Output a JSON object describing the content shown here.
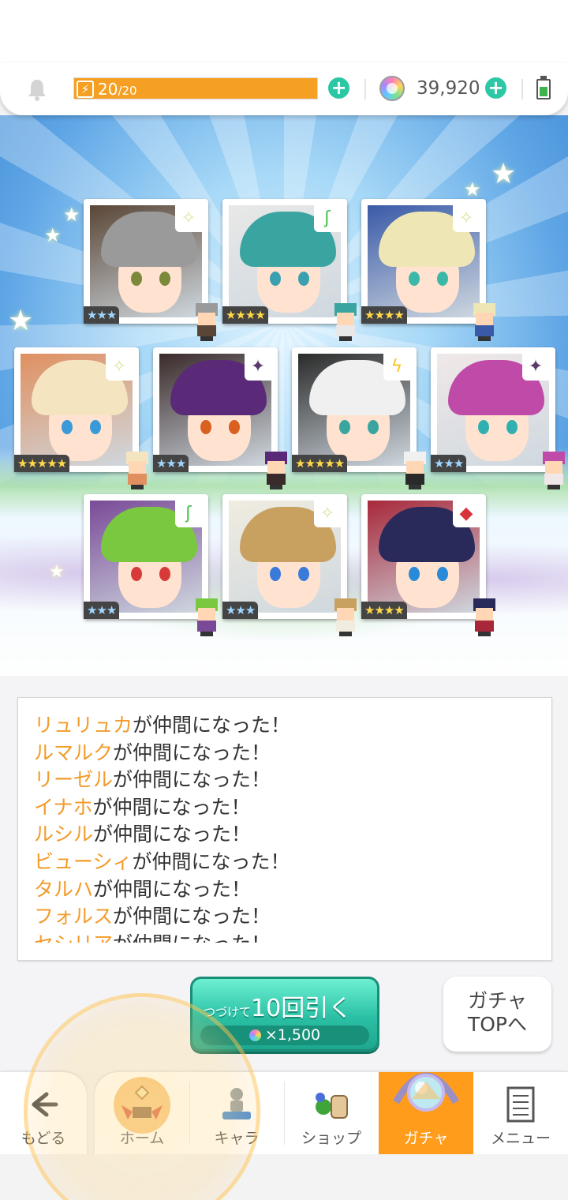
{
  "status": {
    "stamina_current": "20",
    "stamina_max": "/20",
    "stamina_fraction": 1.0,
    "stamina_icon": "lightning-icon",
    "gem_count": "39,920",
    "plus_symbol": "+"
  },
  "cards": [
    {
      "rarity": "★★★",
      "element": "✧",
      "element_color": "#d7e6a0",
      "hair": "#9a9a9a",
      "eye": "#7a8a3a",
      "accent": "#5a4636"
    },
    {
      "rarity": "★★★★",
      "element": "ʃ",
      "element_color": "#45c04a",
      "hair": "#3aa5a0",
      "eye": "#3aa0b0",
      "accent": "#e8e8e8"
    },
    {
      "rarity": "★★★★",
      "element": "✧",
      "element_color": "#d7e6a0",
      "hair": "#efe6b5",
      "eye": "#3cb8a8",
      "accent": "#3a5aa8"
    },
    {
      "rarity": "★★★★★",
      "element": "✧",
      "element_color": "#d7e6a0",
      "hair": "#f5e4c0",
      "eye": "#3a9ad8",
      "accent": "#e09060"
    },
    {
      "rarity": "★★★",
      "element": "✦",
      "element_color": "#5a3a6a",
      "hair": "#5a2a78",
      "eye": "#d86020",
      "accent": "#3a2a2a"
    },
    {
      "rarity": "★★★★★",
      "element": "ϟ",
      "element_color": "#f4c71e",
      "hair": "#f0f0f0",
      "eye": "#3aa5a0",
      "accent": "#2a2a2a"
    },
    {
      "rarity": "★★★",
      "element": "✦",
      "element_color": "#5a3a6a",
      "hair": "#c04aa8",
      "eye": "#30b0b0",
      "accent": "#f0e8e8"
    },
    {
      "rarity": "★★★",
      "element": "ʃ",
      "element_color": "#45c04a",
      "hair": "#7ac840",
      "eye": "#d83a3a",
      "accent": "#7a4a98"
    },
    {
      "rarity": "★★★",
      "element": "✧",
      "element_color": "#d7e6a0",
      "hair": "#c8a060",
      "eye": "#3a7ad8",
      "accent": "#f0ece0"
    },
    {
      "rarity": "★★★★",
      "element": "◆",
      "element_color": "#d8323a",
      "hair": "#2a2a5a",
      "eye": "#2a8ad8",
      "accent": "#a8283a"
    }
  ],
  "log": [
    {
      "name": "リュリュカ",
      "suffix": "が仲間になった！"
    },
    {
      "name": "ルマルク",
      "suffix": "が仲間になった！"
    },
    {
      "name": "リーゼル",
      "suffix": "が仲間になった！"
    },
    {
      "name": "イナホ",
      "suffix": "が仲間になった！"
    },
    {
      "name": "ルシル",
      "suffix": "が仲間になった！"
    },
    {
      "name": "ビューシィ",
      "suffix": "が仲間になった！"
    },
    {
      "name": "タルハ",
      "suffix": "が仲間になった！"
    },
    {
      "name": "フォルス",
      "suffix": "が仲間になった！"
    },
    {
      "name": "セシリア",
      "suffix": "が仲間になった！"
    }
  ],
  "actions": {
    "continue_prefix": "つづけて",
    "continue_label": "10回引く",
    "continue_cost": "×1,500",
    "gacha_top_line1": "ガチャ",
    "gacha_top_line2": "TOPへ"
  },
  "nav": {
    "back": "もどる",
    "home": "ホーム",
    "chara": "キャラ",
    "shop": "ショップ",
    "gacha": "ガチャ",
    "menu": "メニュー"
  },
  "colors": {
    "accent_orange": "#f6a023",
    "accent_green": "#2cc8a6",
    "name_orange": "#f39b2b"
  }
}
